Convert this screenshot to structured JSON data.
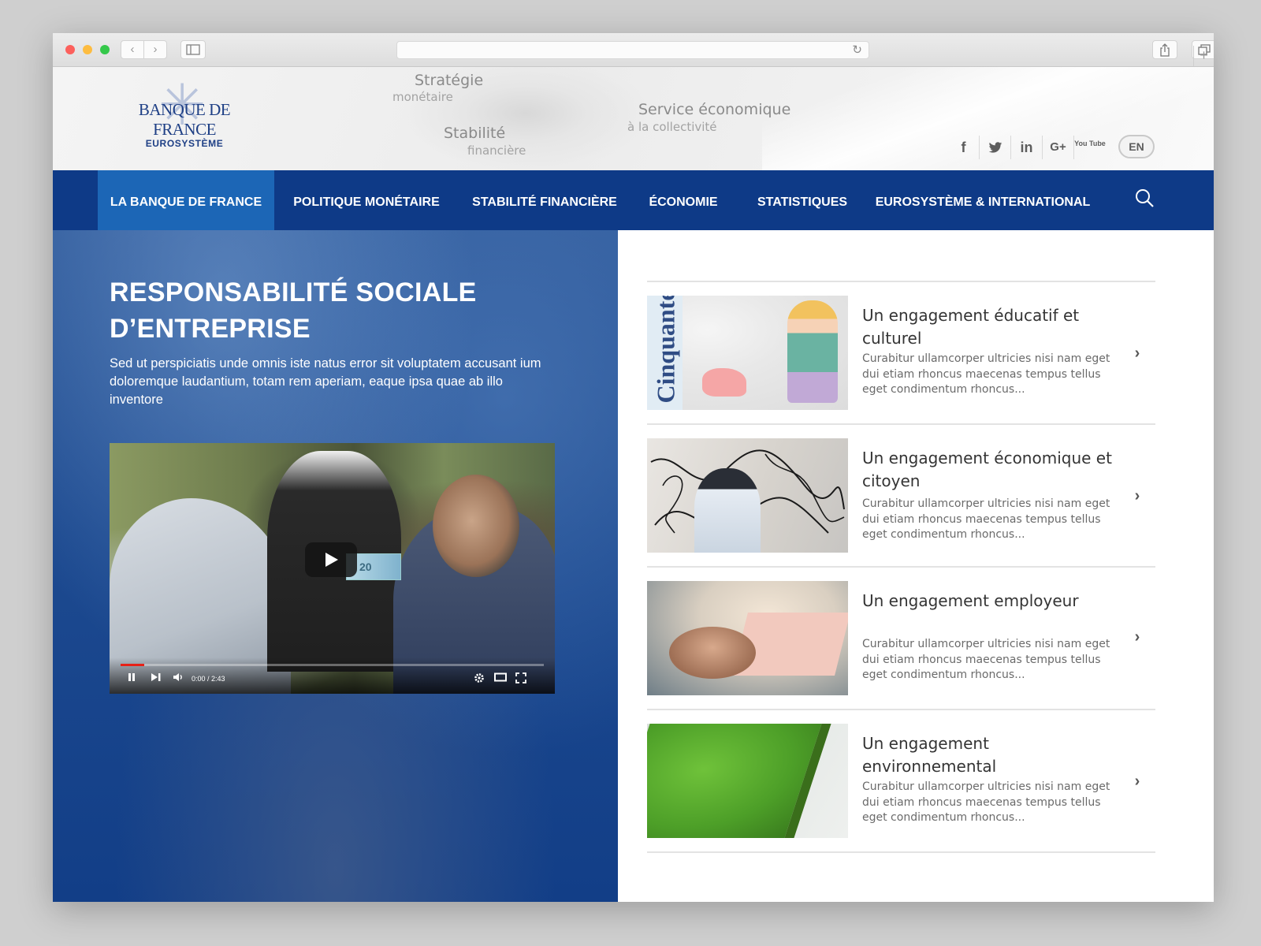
{
  "browser": {
    "back_glyph": "‹",
    "forward_glyph": "›",
    "reload_glyph": "↻",
    "new_tab_glyph": "+",
    "icons": [
      "close-dot",
      "minimize-dot",
      "zoom-dot",
      "back-icon",
      "forward-icon",
      "sidebar-icon",
      "reload-icon",
      "share-icon",
      "tabs-icon",
      "new-tab-icon"
    ]
  },
  "header": {
    "logo": {
      "name": "BANQUE DE FRANCE",
      "sub": "EUROSYSTÈME"
    },
    "mottos": [
      {
        "text": "Stratégie"
      },
      {
        "text": "monétaire"
      },
      {
        "text": "Stabilité"
      },
      {
        "text": "financière"
      },
      {
        "text": "Service économique"
      },
      {
        "text": "à la collectivité"
      }
    ],
    "social": [
      {
        "label": "f",
        "icon": "facebook-icon"
      },
      {
        "label": "🐦",
        "icon": "twitter-icon"
      },
      {
        "label": "in",
        "icon": "linkedin-icon"
      },
      {
        "label": "G+",
        "icon": "google-plus-icon"
      },
      {
        "label": "You Tube",
        "icon": "youtube-icon"
      }
    ],
    "lang": "EN"
  },
  "nav": {
    "items": [
      {
        "label": "LA BANQUE DE FRANCE",
        "active": true
      },
      {
        "label": "POLITIQUE MONÉTAIRE",
        "active": false
      },
      {
        "label": "STABILITÉ FINANCIÈRE",
        "active": false
      },
      {
        "label": "ÉCONOMIE",
        "active": false
      },
      {
        "label": "STATISTIQUES",
        "active": false
      },
      {
        "label": "EUROSYSTÈME & INTERNATIONAL",
        "active": false
      }
    ],
    "search_icon": "search-icon"
  },
  "hero": {
    "title": "RESPONSABILITÉ SOCIALE D’ENTREPRISE",
    "text": "Sed ut perspiciatis unde omnis iste natus error sit voluptatem accusant ium doloremque laudantium, totam rem aperiam, eaque ipsa quae ab illo inventore",
    "video": {
      "time": "0:00 / 2:43",
      "progress": 0.055,
      "banknote": "20",
      "controls": [
        "pause-icon",
        "next-icon",
        "volume-icon",
        "settings-icon",
        "theater-icon",
        "fullscreen-icon"
      ]
    }
  },
  "cards": [
    {
      "title": "Un engagement éducatif et culturel",
      "text": "Curabitur ullamcorper ultricies nisi nam eget dui etiam rhoncus maecenas tempus tellus eget condimentum rhoncus...",
      "image_word": "Cinquante"
    },
    {
      "title": "Un engagement économique et citoyen",
      "text": "Curabitur ullamcorper ultricies nisi nam eget dui etiam rhoncus maecenas tempus tellus eget condimentum rhoncus..."
    },
    {
      "title": "Un engagement employeur",
      "text": "Curabitur ullamcorper ultricies nisi nam eget dui etiam rhoncus maecenas tempus tellus eget condimentum rhoncus..."
    },
    {
      "title": "Un engagement environnemental",
      "text": "Curabitur ullamcorper ultricies nisi nam eget dui etiam rhoncus maecenas tempus tellus eget condimentum rhoncus..."
    }
  ],
  "colors": {
    "nav": "#0e3a87",
    "nav_active": "#1c66b6",
    "brand": "#1e3f85",
    "progress": "#e62117"
  }
}
